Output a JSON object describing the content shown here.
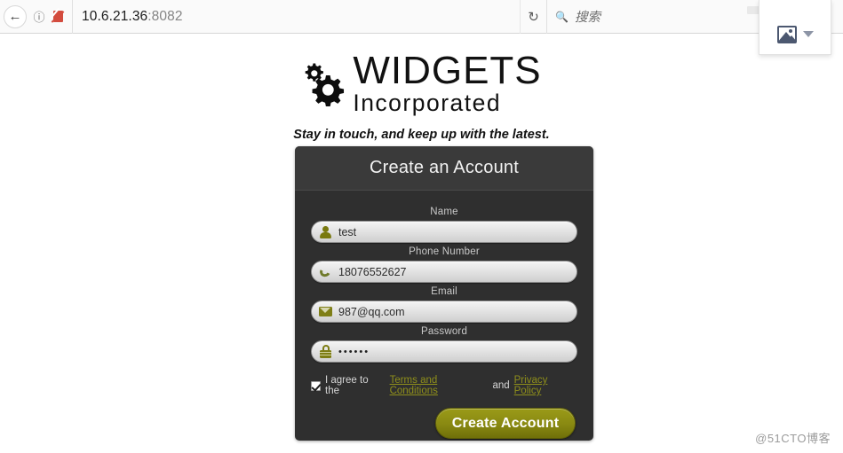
{
  "browser": {
    "back_icon": "back-arrow-icon",
    "info_icon": "info-circle-icon",
    "security_icon": "insecure-page-icon",
    "url_host": "10.6.21.36",
    "url_port": ":8082",
    "reload_icon": "reload-icon",
    "search_icon": "search-icon",
    "search_placeholder": "搜索",
    "popup": {
      "image_icon": "picture-icon",
      "caret_icon": "chevron-down-icon"
    }
  },
  "site": {
    "logo_icon": "gears-icon",
    "logo_main": "WIDGETS",
    "logo_sub": "Incorporated",
    "tagline": "Stay in touch, and keep up with the latest."
  },
  "form": {
    "title": "Create an Account",
    "fields": [
      {
        "label": "Name",
        "value": "test",
        "icon": "user-icon",
        "placeholder": "Name"
      },
      {
        "label": "Phone Number",
        "value": "18076552627",
        "icon": "phone-icon",
        "placeholder": "Phone Number"
      },
      {
        "label": "Email",
        "value": "987@qq.com",
        "icon": "mail-icon",
        "placeholder": "Email"
      },
      {
        "label": "Password",
        "value": "••••••",
        "icon": "lock-icon",
        "placeholder": "Password"
      }
    ],
    "agree": {
      "checked": true,
      "prefix": "I agree to the",
      "terms_link": "Terms and Conditions",
      "joiner": "and",
      "privacy_link": "Privacy Policy"
    },
    "submit_label": "Create Account"
  },
  "watermark": "@51CTO博客",
  "colors": {
    "card_bg": "#2f2f2f",
    "card_head_bg": "#3a3a3a",
    "accent_olive": "#8a8a12",
    "link_olive": "#8f8f1b"
  }
}
